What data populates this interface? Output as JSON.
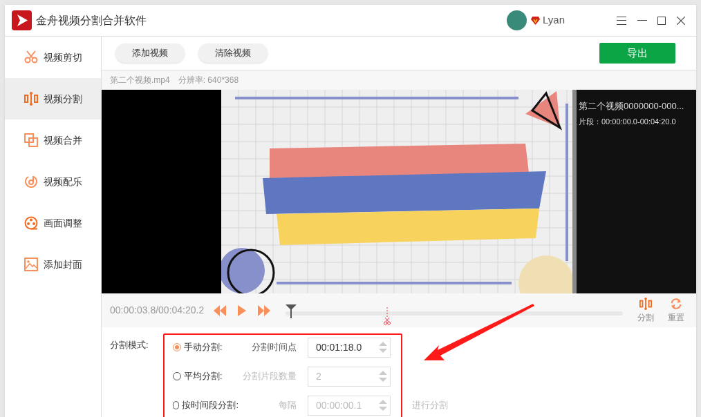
{
  "window": {
    "title": "金舟视频分割合并软件",
    "user": "Lyan"
  },
  "sidebar": {
    "items": [
      {
        "label": "视频剪切",
        "kind": "scissors",
        "selected": false
      },
      {
        "label": "视频分割",
        "kind": "split",
        "selected": true
      },
      {
        "label": "视频合并",
        "kind": "merge",
        "selected": false
      },
      {
        "label": "视频配乐",
        "kind": "music",
        "selected": false
      },
      {
        "label": "画面调整",
        "kind": "film",
        "selected": false
      },
      {
        "label": "添加封面",
        "kind": "image",
        "selected": false
      }
    ]
  },
  "toolbar": {
    "buttons": [
      "添加视频",
      "清除视频"
    ],
    "export": "导出"
  },
  "file_info": {
    "name": "第二个视频.mp4",
    "resolution": "分辨率: 640*368"
  },
  "segments": [
    {
      "title": "第二个视频0000000-000...",
      "range": "片段：00:00:00.0-00:04:20.0"
    }
  ],
  "timeline": {
    "time": "00:00:03.8/00:04:20.2",
    "level": 0.016,
    "split_marker": {
      "level": 0.297
    },
    "actions": [
      {
        "label": "分割",
        "kind": "split"
      },
      {
        "label": "重置",
        "kind": "reset"
      }
    ]
  },
  "split_mode": {
    "label": "分割模式:",
    "options": [
      {
        "label": "手动分割:",
        "field_label": "分割时间点",
        "value": "00:01:18.0",
        "selected": true
      },
      {
        "label": "平均分割:",
        "field_label": "分割片段数量",
        "value": "2",
        "selected": false
      },
      {
        "label": "按时间段分割:",
        "field_label": "每隔",
        "value": "00:00:00.1",
        "suffix": "进行分割",
        "selected": false
      }
    ]
  }
}
